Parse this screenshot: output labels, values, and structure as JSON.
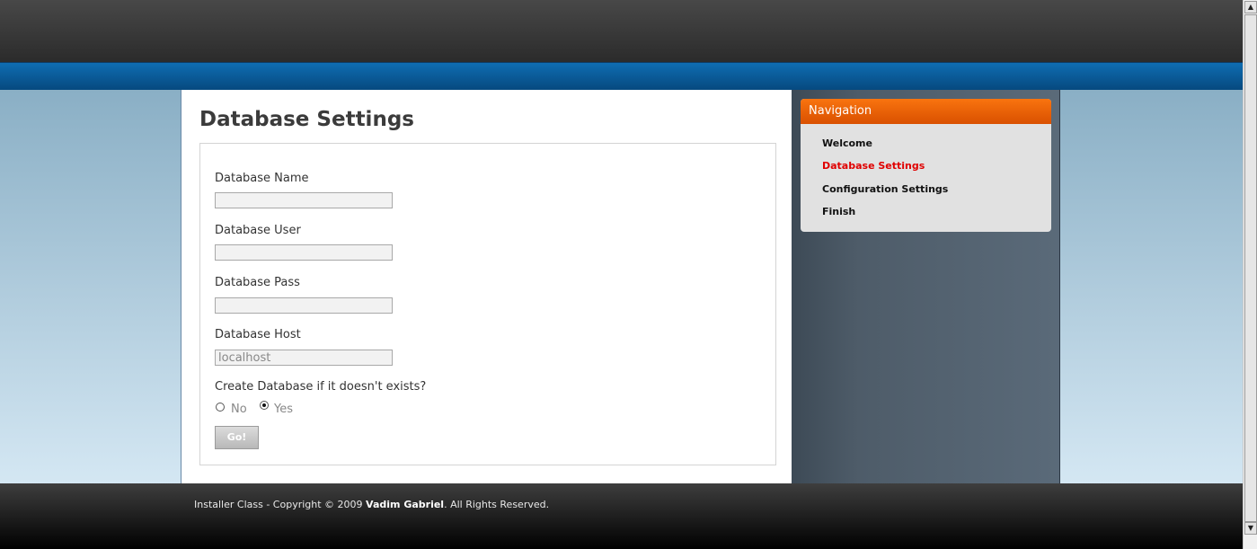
{
  "page": {
    "title": "Database Settings"
  },
  "form": {
    "db_name_label": "Database Name",
    "db_name_value": "",
    "db_user_label": "Database User",
    "db_user_value": "",
    "db_pass_label": "Database Pass",
    "db_pass_value": "",
    "db_host_label": "Database Host",
    "db_host_value": "localhost",
    "create_db_label": "Create Database if it doesn't exists?",
    "option_no": "No",
    "option_yes": "Yes",
    "create_db_selected": "Yes",
    "submit_label": "Go!"
  },
  "navigation": {
    "header": "Navigation",
    "items": [
      {
        "label": "Welcome",
        "active": false
      },
      {
        "label": "Database Settings",
        "active": true
      },
      {
        "label": "Configuration Settings",
        "active": false
      },
      {
        "label": "Finish",
        "active": false
      }
    ]
  },
  "footer": {
    "prefix": "Installer Class - Copyright © 2009 ",
    "author": "Vadim Gabriel",
    "suffix": ". All Rights Reserved."
  },
  "colors": {
    "nav_header": "#e9650a",
    "nav_active": "#e00000",
    "blue_bar": "#0a5c9c"
  },
  "icons": {
    "scroll_up": "scroll-up-arrow-icon",
    "scroll_down": "scroll-down-arrow-icon"
  }
}
